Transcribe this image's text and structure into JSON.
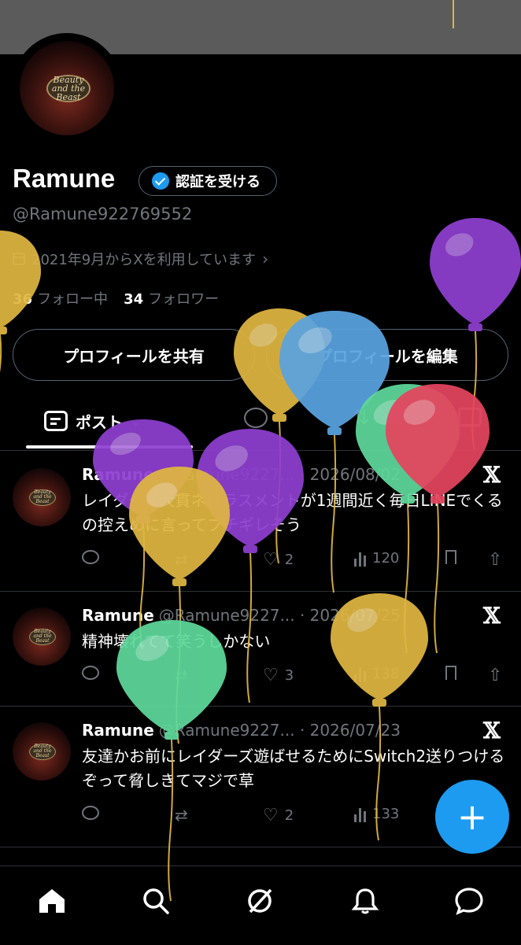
{
  "profile": {
    "avatar_text": "Beauty and the Beast",
    "name": "Ramune",
    "verify_label": "認証を受ける",
    "handle": "@Ramune922769552",
    "joined": "2021年9月からXを利用しています",
    "following_count": "36",
    "following_label": "フォロー中",
    "followers_count": "34",
    "followers_label": "フォロワー",
    "share_label": "プロフィールを共有",
    "edit_label": "プロフィールを編集"
  },
  "tabs": {
    "posts_label": "ポスト",
    "posts_chevron": "⌄"
  },
  "tweets": [
    {
      "name": "Ramune",
      "meta": "@Ramune9227... · 2026/08/02",
      "text": "レイダーズ大貫ネハラスメントが1週間近く毎日LINEでくるの控えめに言ってブチギレそう",
      "reply": "",
      "retweet": "",
      "like": "2",
      "views": "120"
    },
    {
      "name": "Ramune",
      "meta": "@Ramune9227... · 2026/07/25",
      "text": "精神壊れてて笑うしかない",
      "reply": "",
      "retweet": "",
      "like": "3",
      "views": "138"
    },
    {
      "name": "Ramune",
      "meta": "@Ramune9227... · 2026/07/23",
      "text": "友達かお前にレイダーズ遊ばせるためにSwitch2送りつけるぞって脅しきてマジで草",
      "reply": "",
      "retweet": "",
      "like": "2",
      "views": "133"
    }
  ],
  "fab_label": "+",
  "icons": {
    "x_logo": "𝕏",
    "verified": "verified-badge-icon",
    "calendar": "calendar-icon"
  },
  "colors": {
    "accent": "#1d9bf0",
    "background": "#000000",
    "muted": "#71767b",
    "banner": "#5b5b5b"
  },
  "balloons": [
    {
      "color": "#8e3fd0"
    },
    {
      "color": "#e0b642"
    },
    {
      "color": "#5aa3e0"
    },
    {
      "color": "#e0b642"
    },
    {
      "color": "#5aa3e0"
    },
    {
      "color": "#5ed99b"
    },
    {
      "color": "#e5455f"
    },
    {
      "color": "#8e3fd0"
    },
    {
      "color": "#8e3fd0"
    },
    {
      "color": "#e0b642"
    },
    {
      "color": "#e0b642"
    },
    {
      "color": "#5ed99b"
    }
  ]
}
